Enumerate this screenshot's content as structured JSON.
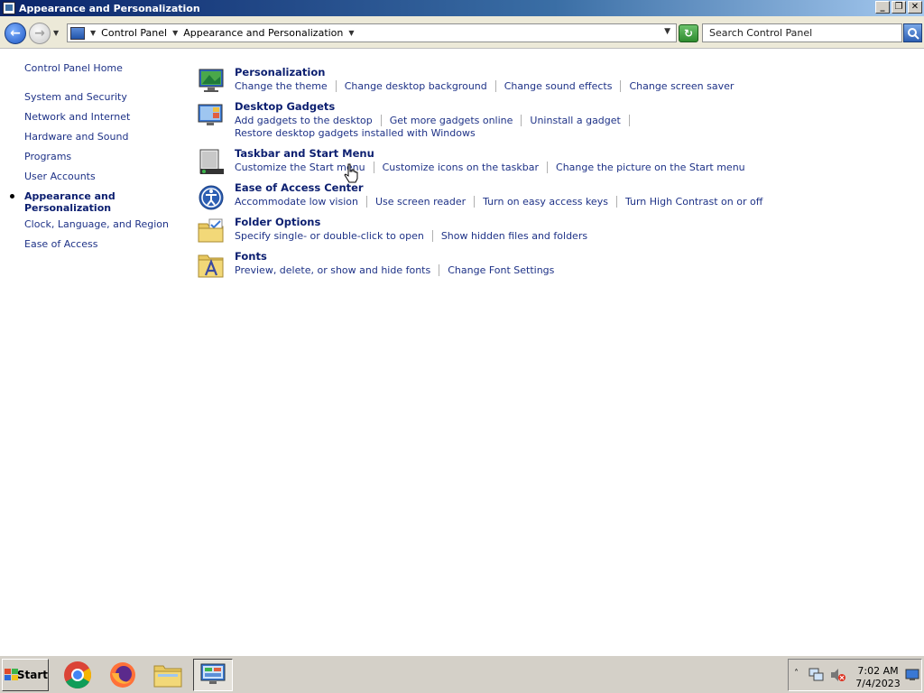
{
  "window": {
    "title": "Appearance and Personalization",
    "controls": {
      "minimize": "_",
      "maximize": "❐",
      "close": "✕"
    }
  },
  "navbar": {
    "back_icon": "back-arrow-icon",
    "forward_icon": "forward-arrow-icon",
    "breadcrumb": [
      "Control Panel",
      "Appearance and Personalization"
    ],
    "search_placeholder": "Search Control Panel"
  },
  "sidebar": {
    "home": "Control Panel Home",
    "items": [
      {
        "label": "System and Security"
      },
      {
        "label": "Network and Internet"
      },
      {
        "label": "Hardware and Sound"
      },
      {
        "label": "Programs"
      },
      {
        "label": "User Accounts"
      },
      {
        "label": "Appearance and\nPersonalization",
        "active": true
      },
      {
        "label": "Clock, Language, and Region"
      },
      {
        "label": "Ease of Access"
      }
    ]
  },
  "categories": [
    {
      "title": "Personalization",
      "icon": "personalization-icon",
      "links": [
        "Change the theme",
        "Change desktop background",
        "Change sound effects",
        "Change screen saver"
      ]
    },
    {
      "title": "Desktop Gadgets",
      "icon": "gadgets-icon",
      "links": [
        "Add gadgets to the desktop",
        "Get more gadgets online",
        "Uninstall a gadget"
      ],
      "links2": [
        "Restore desktop gadgets installed with Windows"
      ]
    },
    {
      "title": "Taskbar and Start Menu",
      "icon": "taskbar-icon",
      "links": [
        "Customize the Start menu",
        "Customize icons on the taskbar",
        "Change the picture on the Start menu"
      ]
    },
    {
      "title": "Ease of Access Center",
      "icon": "ease-of-access-icon",
      "links": [
        "Accommodate low vision",
        "Use screen reader",
        "Turn on easy access keys",
        "Turn High Contrast on or off"
      ]
    },
    {
      "title": "Folder Options",
      "icon": "folder-icon",
      "links": [
        "Specify single- or double-click to open",
        "Show hidden files and folders"
      ]
    },
    {
      "title": "Fonts",
      "icon": "fonts-icon",
      "links": [
        "Preview, delete, or show and hide fonts",
        "Change Font Settings"
      ]
    }
  ],
  "taskbar": {
    "start_label": "Start",
    "apps": [
      "chrome-icon",
      "firefox-icon",
      "explorer-icon",
      "control-panel-icon"
    ],
    "clock_time": "7:02 AM",
    "clock_date": "7/4/2023"
  }
}
